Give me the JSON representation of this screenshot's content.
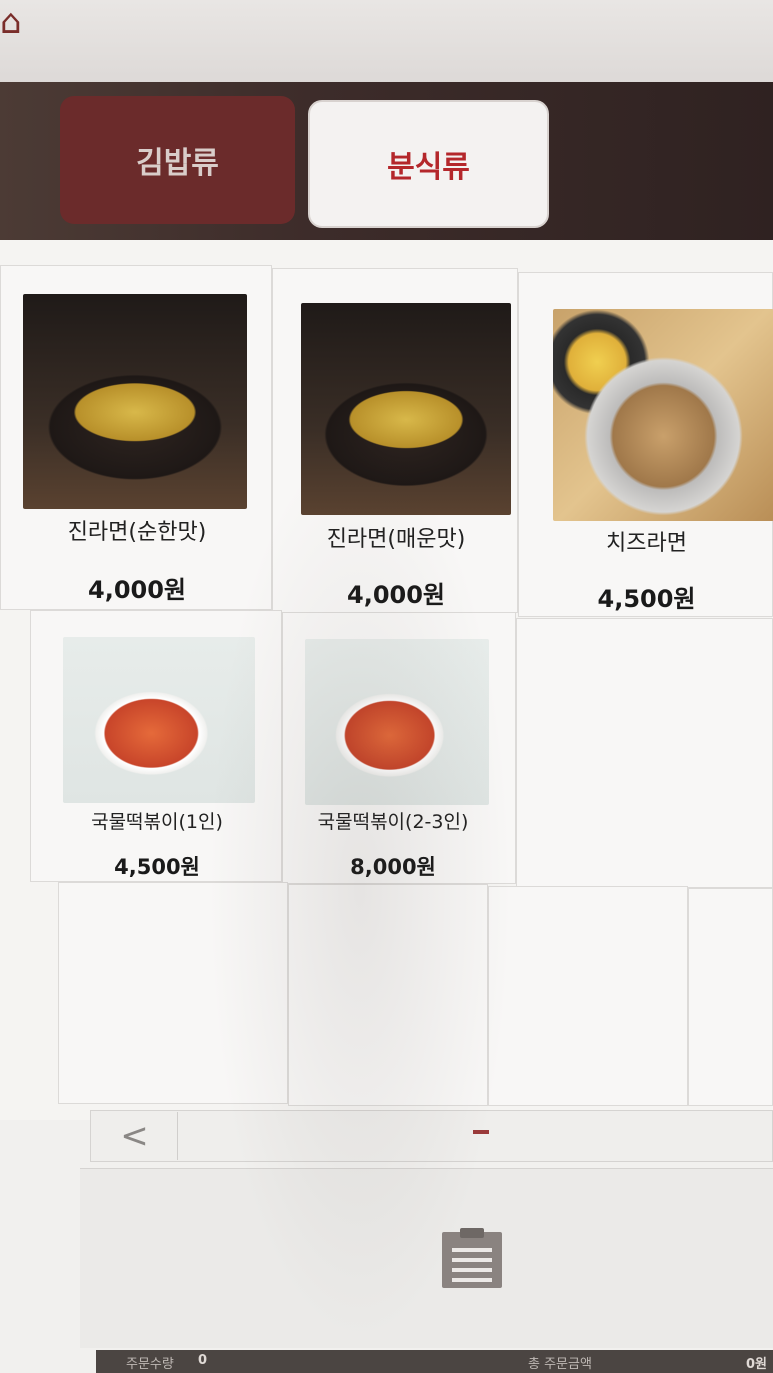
{
  "header": {
    "home_icon": "home-icon"
  },
  "categories": {
    "tabs": [
      {
        "label": "김밥류",
        "active": false
      },
      {
        "label": "분식류",
        "active": true
      }
    ]
  },
  "menu": {
    "items": [
      {
        "name": "진라면(순한맛)",
        "price": "4,000원",
        "image": "ramen"
      },
      {
        "name": "진라면(매운맛)",
        "price": "4,000원",
        "image": "ramen"
      },
      {
        "name": "치즈라면",
        "price": "4,500원",
        "image": "cheese-ramen"
      },
      {
        "name": "국물떡볶이(1인)",
        "price": "4,500원",
        "image": "tteokbokki"
      },
      {
        "name": "국물떡볶이(2-3인)",
        "price": "8,000원",
        "image": "tteokbokki"
      }
    ]
  },
  "pager": {
    "prev_label": "<"
  },
  "order": {
    "icon": "clipboard-icon",
    "qty_label": "주문수량",
    "qty_value": "0",
    "total_label": "총 주문금액",
    "total_value": "0원"
  },
  "colors": {
    "accent": "#b4272b",
    "tab_inactive": "#6b2b2b",
    "category_bar": "#3d2c2a"
  }
}
